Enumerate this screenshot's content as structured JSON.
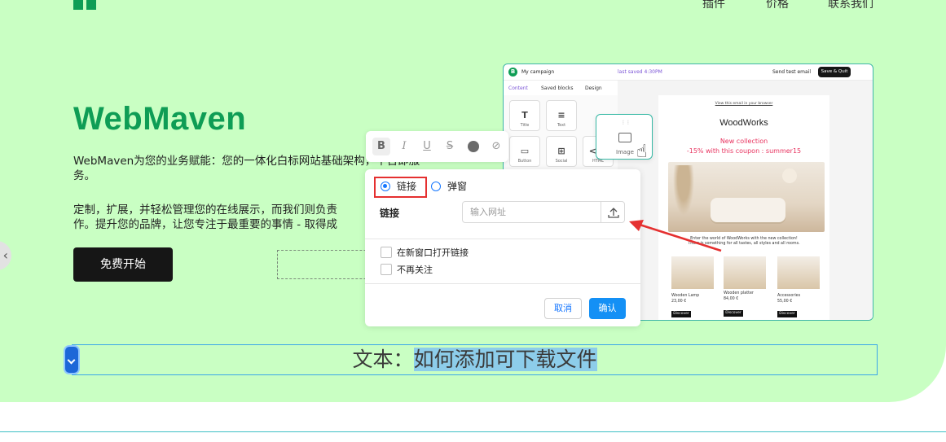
{
  "nav": {
    "items": [
      "插件",
      "价格",
      "联系我们"
    ]
  },
  "hero": {
    "brand": "WebMaven",
    "desc1": "WebMaven为您的业务赋能：您的一体化白标网站基础架构，平台即服\n务。",
    "desc2": "定制，扩展，并轻松管理您的在线展示，而我们则负责\n作。提升您的品牌，让您专注于最重要的事情 - 取得成",
    "cta": "免费开始"
  },
  "preview": {
    "badge": "B",
    "title": "My campaign",
    "saved": "last saved 4:30PM",
    "send": "Send test email",
    "save_quit": "Save & Quit",
    "tabs": [
      "Content",
      "Saved blocks",
      "Design"
    ],
    "tiles": [
      {
        "glyph": "T",
        "label": "Title"
      },
      {
        "glyph": "≡",
        "label": "Text"
      },
      {
        "glyph": "▭",
        "label": "Button"
      },
      {
        "glyph": "⊞",
        "label": "Social"
      },
      {
        "glyph": "</>",
        "label": "HTML"
      }
    ],
    "drag_label": "Image",
    "mail": {
      "view_link": "View this email in your browser",
      "brand": "WoodWorks",
      "promo1": "New collection",
      "promo2": "-15% with this coupon : summer15",
      "copy": "Enter the world of WoodWorks with the new collection!\nThere is something for all tastes, all styles and all rooms.",
      "products": [
        {
          "name": "Wooden Lamp",
          "price": "23,00 €",
          "cta": "Discover"
        },
        {
          "name": "Wooden platter",
          "price": "84,00 €",
          "cta": "Discover"
        },
        {
          "name": "Accessories",
          "price": "55,00 €",
          "cta": "Discover"
        }
      ]
    }
  },
  "toolbar": {
    "icons": [
      "bold-icon",
      "italic-icon",
      "underline-icon",
      "strikethrough-icon",
      "color-icon",
      "link-icon"
    ],
    "glyphs": {
      "bold": "B",
      "italic": "I",
      "underline": "U",
      "strike": "S",
      "link": "⊘"
    }
  },
  "link_panel": {
    "radio_link": "链接",
    "radio_popup": "弹窗",
    "link_label": "链接",
    "url_placeholder": "输入网址",
    "open_new_window": "在新窗口打开链接",
    "no_follow": "不再关注",
    "cancel": "取消",
    "confirm": "确认"
  },
  "caption": {
    "prefix": "文本：",
    "highlighted": "如何添加可下载文件"
  },
  "colors": {
    "hero_bg": "#c9ffc3",
    "brand_green": "#0e9d55",
    "primary_blue": "#1490f5",
    "annotation_red": "#e53030",
    "highlight": "#8dcdea"
  }
}
